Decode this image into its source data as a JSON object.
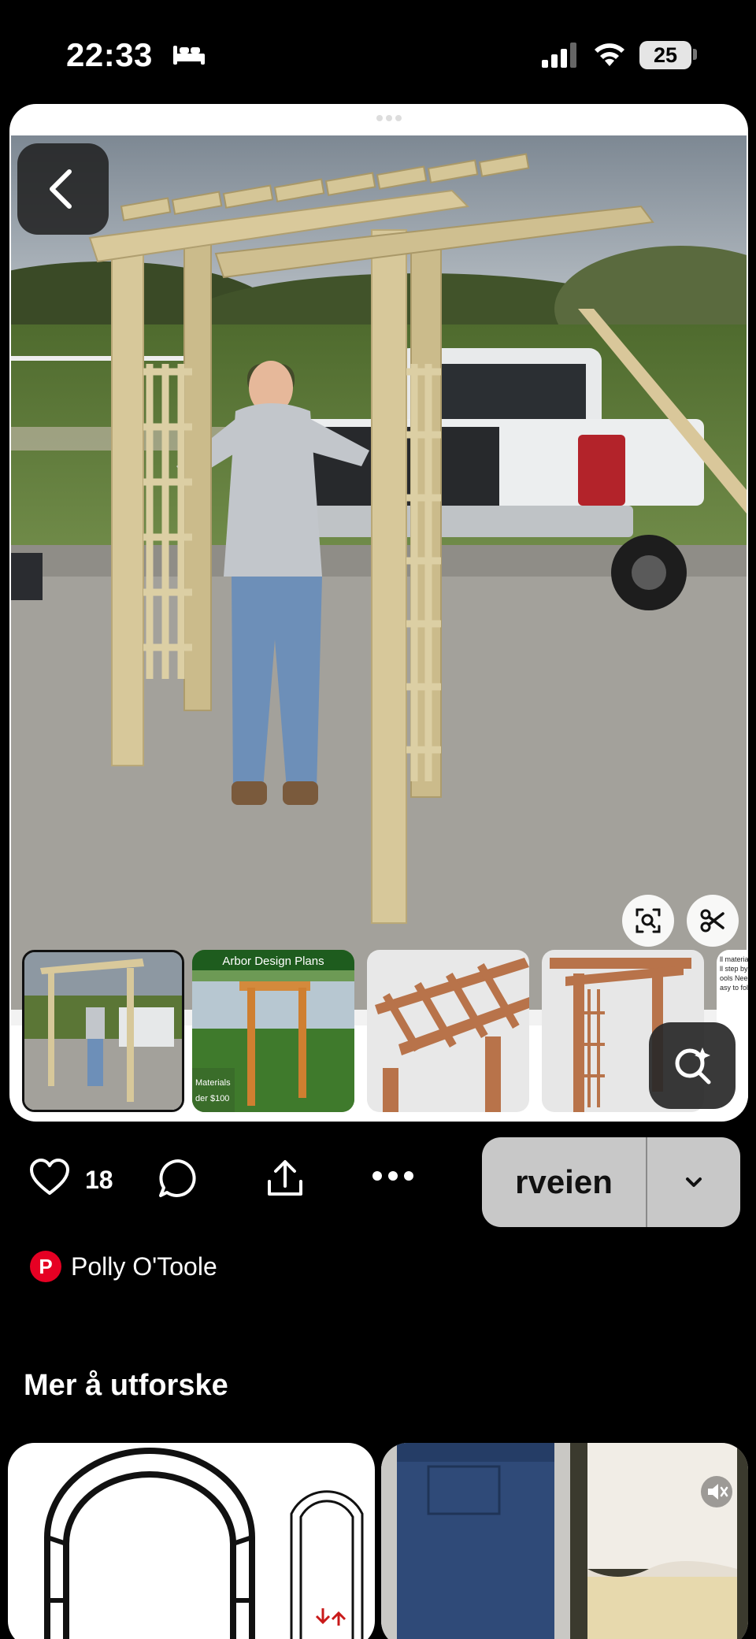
{
  "status_bar": {
    "time": "22:33",
    "battery": "25"
  },
  "pin": {
    "image_description_icon": "photo",
    "thumbnails": [
      {
        "name": "thumb-arbor-photo"
      },
      {
        "name": "thumb-arbor-design-plans",
        "title": "Arbor Design Plans",
        "caption": "Materials\nder $100"
      },
      {
        "name": "thumb-arbor-render"
      },
      {
        "name": "thumb-arbor-side"
      },
      {
        "name": "thumb-text",
        "text": "ll material\nll step by s\nools Neede\nasy to follo"
      }
    ]
  },
  "actions": {
    "like_count": "18",
    "visit_label": "rveien"
  },
  "author": {
    "initial": "P",
    "name": "Polly O'Toole"
  },
  "section": {
    "title": "Mer å utforske"
  },
  "colors": {
    "brand": "#e60023",
    "visit_bg": "#c8c8c8"
  }
}
